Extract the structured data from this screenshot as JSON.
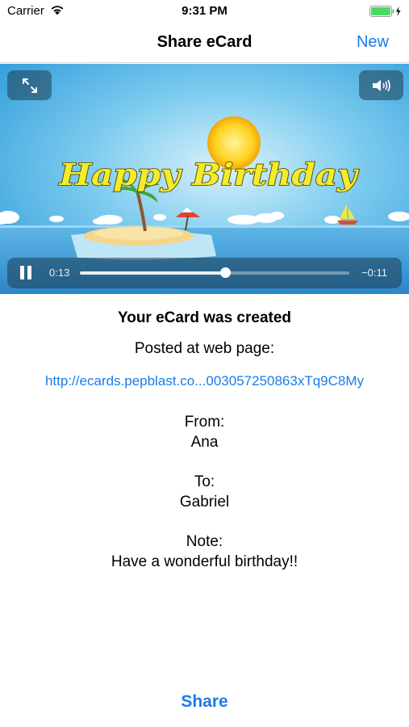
{
  "status_bar": {
    "carrier": "Carrier",
    "time": "9:31 PM"
  },
  "nav": {
    "title": "Share eCard",
    "right_button": "New"
  },
  "video": {
    "card_text": "Happy Birthday",
    "elapsed": "0:13",
    "remaining": "−0:11",
    "progress": 0.54,
    "icons": {
      "expand": "expand-arrows-icon",
      "volume": "speaker-volume-icon",
      "pause": "pause-icon"
    }
  },
  "card": {
    "headline": "Your eCard was created",
    "posted_label": "Posted at web page:",
    "url": "http://ecards.pepblast.co...003057250863xTq9C8My",
    "from_label": "From:",
    "from_value": "Ana",
    "to_label": "To:",
    "to_value": "Gabriel",
    "note_label": "Note:",
    "note_value": "Have a wonderful birthday!!"
  },
  "share_button": "Share",
  "colors": {
    "accent": "#1a7ce8",
    "sky": "#3fa9e4",
    "sea": "#2f93d6",
    "title_yellow": "#f3ec2c"
  }
}
